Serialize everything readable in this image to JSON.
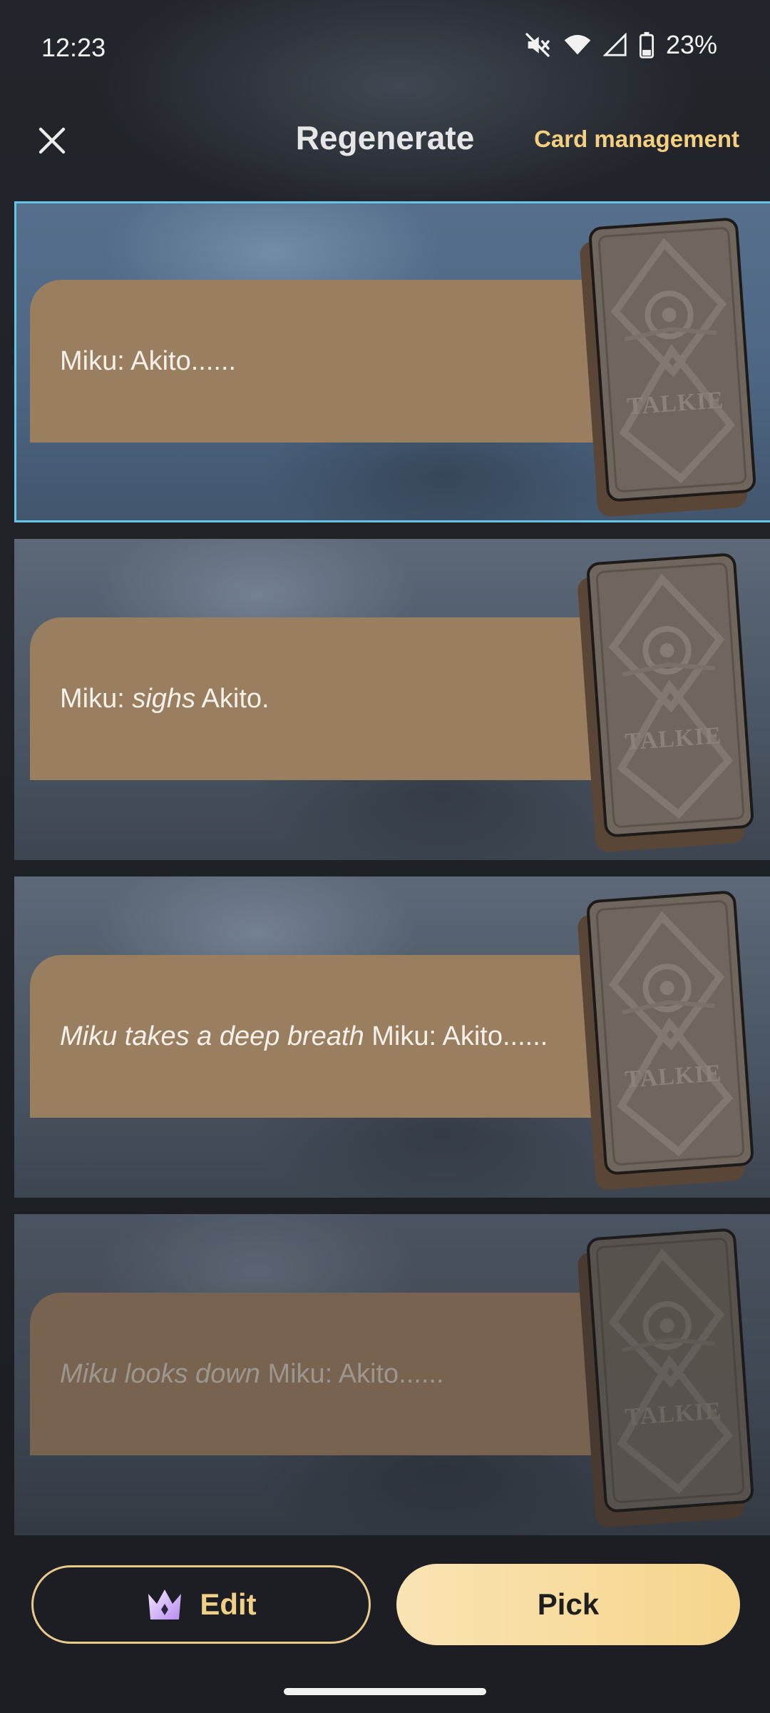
{
  "status_bar": {
    "time": "12:23",
    "battery": "23%",
    "icons": [
      "mute-icon",
      "wifi-icon",
      "signal-icon",
      "battery-icon"
    ]
  },
  "header": {
    "title": "Regenerate",
    "close_icon": "close-icon",
    "card_management": "Card management"
  },
  "options": [
    {
      "segments": [
        {
          "text": "Miku: Akito......",
          "italic": false
        }
      ],
      "selected": true,
      "faded": false
    },
    {
      "segments": [
        {
          "text": "Miku: ",
          "italic": false
        },
        {
          "text": "sighs",
          "italic": true
        },
        {
          "text": " Akito.",
          "italic": false
        }
      ],
      "selected": false,
      "faded": false
    },
    {
      "segments": [
        {
          "text": "Miku takes a deep breath",
          "italic": true
        },
        {
          "text": " Miku: Akito......",
          "italic": false
        }
      ],
      "selected": false,
      "faded": false
    },
    {
      "segments": [
        {
          "text": "Miku looks down",
          "italic": true
        },
        {
          "text": " Miku: Akito......",
          "italic": false
        }
      ],
      "selected": false,
      "faded": true
    }
  ],
  "card_logo": "TALKIE",
  "bottom": {
    "edit_label": "Edit",
    "edit_icon": "crown-icon",
    "pick_label": "Pick"
  },
  "colors": {
    "accent_gold": "#f3cf7f",
    "selected_border": "#63c4e3",
    "bubble": "#9a7e60",
    "pick_gradient_start": "#fae4b4",
    "pick_gradient_end": "#f6d58c"
  }
}
